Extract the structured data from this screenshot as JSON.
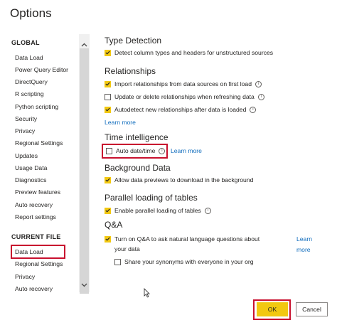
{
  "window": {
    "title": "Options"
  },
  "sidebar": {
    "global_heading": "GLOBAL",
    "global_items": [
      "Data Load",
      "Power Query Editor",
      "DirectQuery",
      "R scripting",
      "Python scripting",
      "Security",
      "Privacy",
      "Regional Settings",
      "Updates",
      "Usage Data",
      "Diagnostics",
      "Preview features",
      "Auto recovery",
      "Report settings"
    ],
    "current_heading": "CURRENT FILE",
    "current_items": [
      "Data Load",
      "Regional Settings",
      "Privacy",
      "Auto recovery"
    ],
    "selected": "Data Load"
  },
  "main": {
    "type_detection": {
      "heading": "Type Detection",
      "options": [
        {
          "label": "Detect column types and headers for unstructured sources",
          "checked": true
        }
      ]
    },
    "relationships": {
      "heading": "Relationships",
      "options": [
        {
          "label": "Import relationships from data sources on first load",
          "checked": true
        },
        {
          "label": "Update or delete relationships when refreshing data",
          "checked": false
        },
        {
          "label": "Autodetect new relationships after data is loaded",
          "checked": true
        }
      ],
      "learn_more": "Learn more"
    },
    "time_intelligence": {
      "heading": "Time intelligence",
      "option": {
        "label": "Auto date/time",
        "checked": false
      },
      "learn_more": "Learn more"
    },
    "background_data": {
      "heading": "Background Data",
      "option": {
        "label": "Allow data previews to download in the background",
        "checked": true
      }
    },
    "parallel_loading": {
      "heading": "Parallel loading of tables",
      "option": {
        "label": "Enable parallel loading of tables",
        "checked": true
      }
    },
    "qa": {
      "heading": "Q&A",
      "option1_line1": "Turn on Q&A to ask natural language questions about",
      "option1_line2": "your data",
      "option1_checked": true,
      "option2": {
        "label": "Share your synonyms with everyone in your org",
        "checked": false
      },
      "learn_more_line1": "Learn",
      "learn_more_line2": "more"
    }
  },
  "buttons": {
    "ok": "OK",
    "cancel": "Cancel"
  },
  "colors": {
    "accent": "#f2c811",
    "highlight": "#c8102e",
    "link": "#0f6cbd"
  },
  "icons": {
    "scroll_up": "chevron-up-icon",
    "scroll_down": "chevron-down-icon",
    "info": "info-icon",
    "cursor": "mouse-pointer-icon"
  }
}
